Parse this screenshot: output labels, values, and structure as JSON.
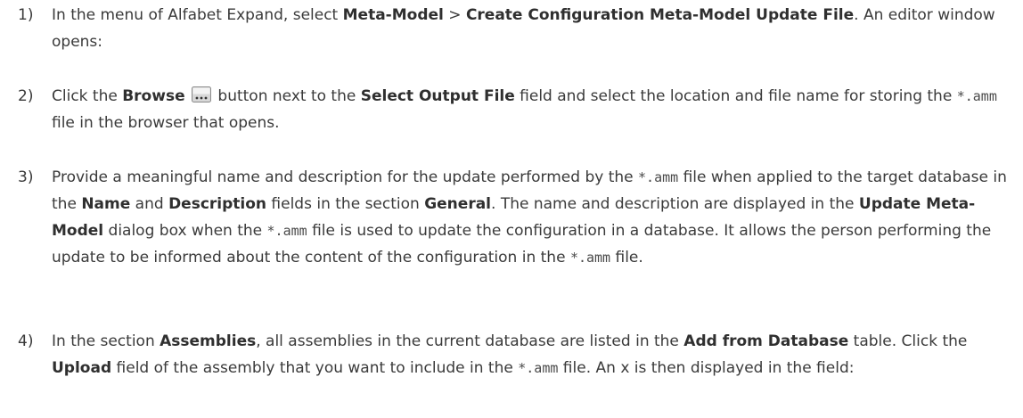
{
  "steps": [
    {
      "number": "1)",
      "t1": "In the menu of Alfabet Expand, select ",
      "b1": "Meta-Model",
      "t2": " > ",
      "b2": "Create Configuration Meta-Model Update File",
      "t3": ". An editor window opens:"
    },
    {
      "number": "2)",
      "t1": "Click the ",
      "b1": "Browse",
      "icon": "browse-button-icon",
      "t2": " button next to the ",
      "b2": "Select Output File",
      "t3": " field and select the location and file name for storing the ",
      "c1": "*.amm",
      "t4": " file in the browser that opens."
    },
    {
      "number": "3)",
      "t1": "Provide a meaningful name and description for the update performed by the ",
      "c1": "*.amm",
      "t2": " file when applied to the target database in the ",
      "b1": "Name",
      "t3": " and ",
      "b2": "Description",
      "t4": " fields in the section ",
      "b3": "General",
      "t5": ". The name and description are displayed in the ",
      "b4": "Update Meta-Model",
      "t6": " dialog box when the ",
      "c2": "*.amm",
      "t7": " file is used to update the configuration in a database. It allows the person performing the update to be informed about the content of the configuration in the ",
      "c3": "*.amm",
      "t8": " file."
    },
    {
      "number": "4)",
      "t1": "In the section ",
      "b1": "Assemblies",
      "t2": ", all assemblies in the current database are listed in the ",
      "b2": "Add from Database",
      "t3": " table. Click the ",
      "b3": "Upload",
      "t4": " field of the assembly that you want to include in the ",
      "c1": "*.amm",
      "t5": " file. An x is then displayed in the field:"
    }
  ],
  "colors": {
    "text": "#3a3a3a",
    "icon_fill": "#d8d8d8",
    "icon_dots": "#333333"
  }
}
